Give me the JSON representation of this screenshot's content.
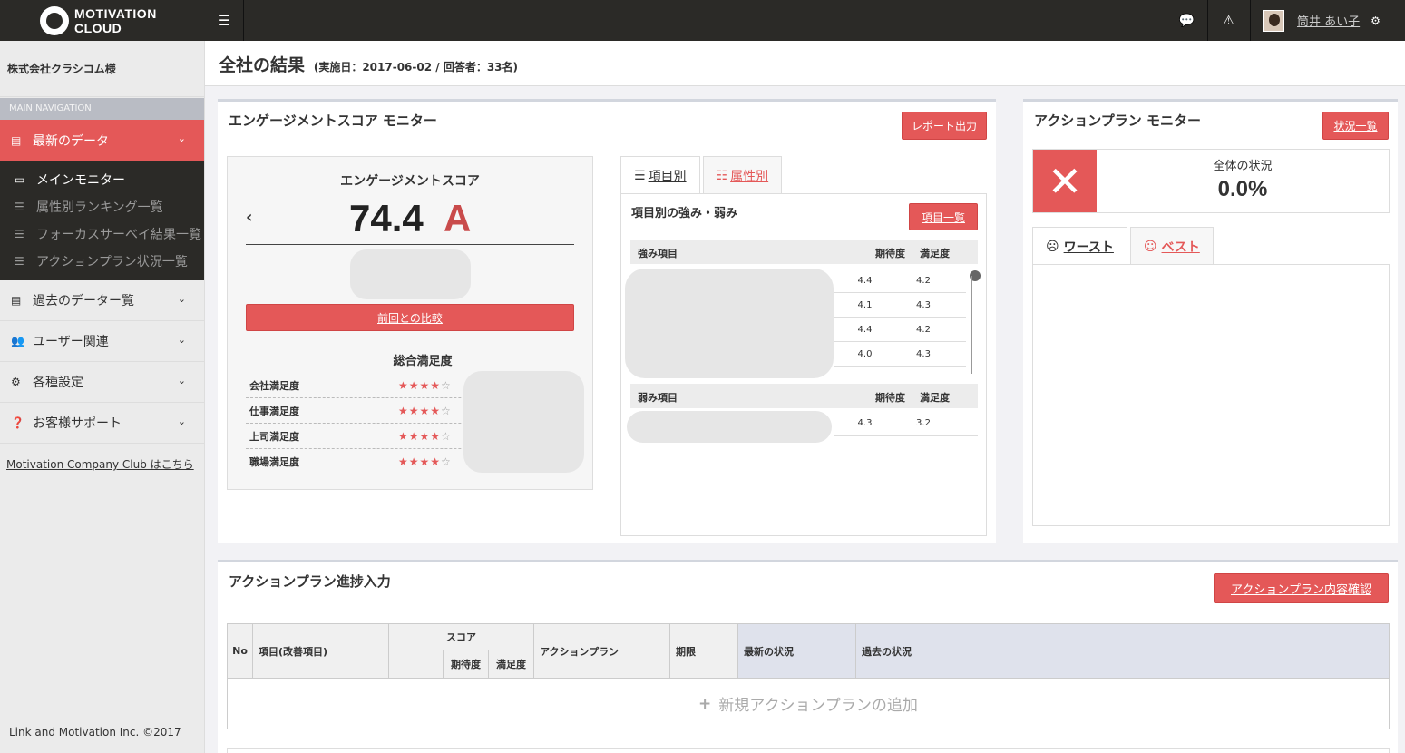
{
  "brand": {
    "line1": "MOTIVATION",
    "line2": "CLOUD"
  },
  "header": {
    "user_name": "筒井 あい子"
  },
  "sidebar": {
    "company": "株式会社クラシコム様",
    "main_nav_label": "MAIN NAVIGATION",
    "active_item": "最新のデータ",
    "sub_items": [
      {
        "label": "メインモニター"
      },
      {
        "label": "属性別ランキング一覧"
      },
      {
        "label": "フォーカスサーベイ結果一覧"
      },
      {
        "label": "アクションプラン状況一覧"
      }
    ],
    "items": [
      {
        "label": "過去のデーター覧"
      },
      {
        "label": "ユーザー関連"
      },
      {
        "label": "各種設定"
      },
      {
        "label": "お客様サポート"
      }
    ],
    "club_link": "Motivation Company Club はこちら",
    "copyright": "Link and Motivation Inc. ©2017"
  },
  "page": {
    "title": "全社の結果",
    "subtitle": "(実施日：2017-06-02 / 回答者：33名)"
  },
  "engagement": {
    "panel_title": "エンゲージメントスコア モニター",
    "report_button": "レポート出力",
    "score_label": "エンゲージメントスコア",
    "score": "74.4",
    "grade": "A",
    "compare_button": "前回との比較",
    "satisfaction_title": "総合満足度",
    "satisfaction": [
      {
        "label": "会社満足度",
        "stars": 4
      },
      {
        "label": "仕事満足度",
        "stars": 4
      },
      {
        "label": "上司満足度",
        "stars": 4
      },
      {
        "label": "職場満足度",
        "stars": 4
      }
    ]
  },
  "items_panel": {
    "tab_items": "項目別",
    "tab_attributes": "属性別",
    "heading": "項目別の強み・弱み",
    "list_button": "項目一覧",
    "strengths_header": {
      "item": "強み項目",
      "expect": "期待度",
      "satisfy": "満足度"
    },
    "strengths": [
      {
        "expect": "4.4",
        "satisfy": "4.2"
      },
      {
        "expect": "4.1",
        "satisfy": "4.3"
      },
      {
        "expect": "4.4",
        "satisfy": "4.2"
      },
      {
        "expect": "4.0",
        "satisfy": "4.3"
      }
    ],
    "weaknesses_header": {
      "item": "弱み項目",
      "expect": "期待度",
      "satisfy": "満足度"
    },
    "weaknesses": [
      {
        "expect": "4.3",
        "satisfy": "3.2"
      }
    ]
  },
  "action_monitor": {
    "panel_title": "アクションプラン モニター",
    "status_button": "状況一覧",
    "overall_label": "全体の状況",
    "overall_value": "0.0%",
    "tab_worst": "ワースト",
    "tab_best": "ベスト"
  },
  "progress": {
    "panel_title": "アクションプラン進捗入力",
    "confirm_button": "アクションプラン内容確認",
    "headers": {
      "no": "No",
      "item": "項目(改善項目)",
      "score": "スコア",
      "expect": "期待度",
      "satisfy": "満足度",
      "plan": "アクションプラン",
      "deadline": "期限",
      "latest": "最新の状況",
      "past": "過去の状況"
    },
    "add_label": "新規アクションプランの追加"
  }
}
